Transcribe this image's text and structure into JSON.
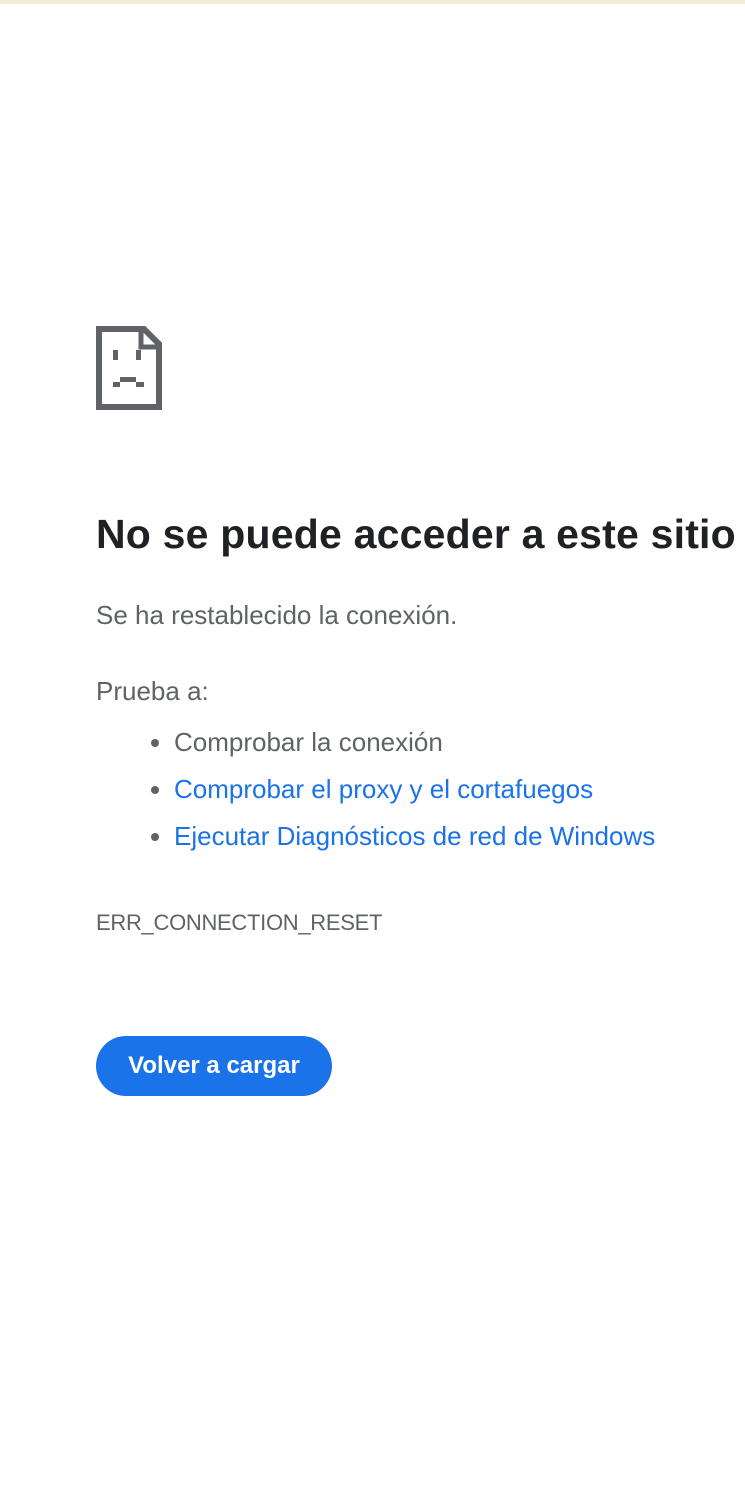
{
  "error_page": {
    "icon": "sad-page-icon",
    "heading": "No se puede acceder a este sitio",
    "summary": "Se ha restablecido la conexión.",
    "suggestions_label": "Prueba a:",
    "suggestions": [
      {
        "text": "Comprobar la conexión",
        "is_link": false
      },
      {
        "text": "Comprobar el proxy y el cortafuegos",
        "is_link": true
      },
      {
        "text": "Ejecutar Diagnósticos de red de Windows",
        "is_link": true
      }
    ],
    "error_code": "ERR_CONNECTION_RESET",
    "reload_button_label": "Volver a cargar"
  },
  "colors": {
    "heading": "#202124",
    "body_text": "#5f6368",
    "link": "#1a73e8",
    "button_background": "#1a73e8",
    "button_text": "#ffffff",
    "top_border": "#f3ead8"
  }
}
